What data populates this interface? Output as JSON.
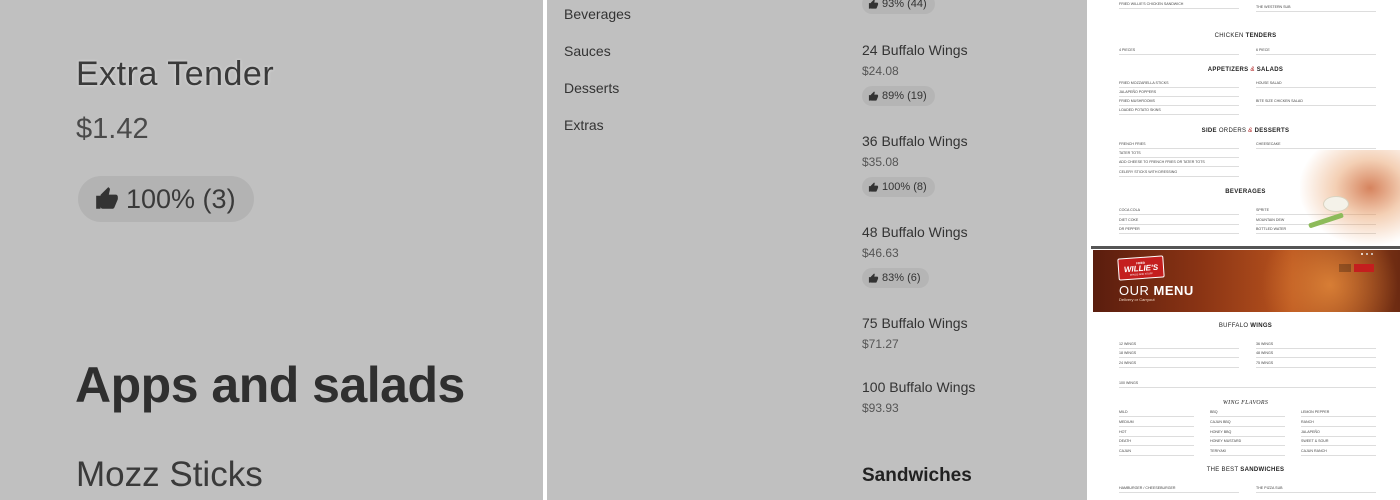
{
  "zoom_panel": {
    "item_name": "Extra Tender",
    "item_price": "$1.42",
    "rating": "100% (3)",
    "section_title": "Apps and salads",
    "next_item": "Mozz Sticks"
  },
  "menu_panel": {
    "categories": [
      "Beverages",
      "Sauces",
      "Desserts",
      "Extras"
    ],
    "top_rating": "93% (44)",
    "items": [
      {
        "name": "24 Buffalo Wings",
        "price": "$24.08",
        "rating": "89% (19)"
      },
      {
        "name": "36 Buffalo Wings",
        "price": "$35.08",
        "rating": "100% (8)"
      },
      {
        "name": "48 Buffalo Wings",
        "price": "$46.63",
        "rating": "83% (6)"
      },
      {
        "name": "75 Buffalo Wings",
        "price": "$71.27"
      },
      {
        "name": "100 Buffalo Wings",
        "price": "$93.93"
      }
    ],
    "next_section": "Sandwiches"
  },
  "website_panel": {
    "top_items": [
      {
        "name": "FRIED WILLIE'S CHICKEN SANDWICH"
      },
      {
        "name": "THE WESTERN SUB"
      }
    ],
    "chicken_tenders": {
      "title_light": "CHICKEN",
      "title_bold": "TENDERS",
      "items": [
        "4 PIECES",
        "6 PIECE"
      ]
    },
    "appetizers": {
      "title_a": "APPETIZERS",
      "amp": "&",
      "title_b": "SALADS",
      "left_items": [
        "FRIED MOZZARELLA STICKS",
        "JALAPEÑO POPPERS",
        "FRIED MUSHROOMS",
        "LOADED POTATO SKINS"
      ],
      "right_items": [
        "HOUSE SALAD",
        "BITE SIZE CHICKEN SALAD"
      ]
    },
    "sides": {
      "title_a": "SIDE",
      "title_light": "ORDERS",
      "amp": "&",
      "title_b": "DESSERTS",
      "left_items": [
        "FRENCH FRIES",
        "TATER TOTS",
        "ADD CHEESE TO FRENCH FRIES OR TATER TOTS",
        "CELERY STICKS WITH DRESSING"
      ],
      "right_items": [
        "CHEESECAKE"
      ]
    },
    "beverages": {
      "title": "BEVERAGES",
      "left_items": [
        "COCA COLA",
        "DIET COKE",
        "DR PEPPER"
      ],
      "right_items": [
        "SPRITE",
        "MOUNTAIN DEW",
        "BOTTLED WATER"
      ]
    },
    "hero": {
      "logo_top": "FRIED",
      "logo_main": "WILLIE'S",
      "logo_bottom": "WINGS AND STUFF",
      "title_light": "OUR",
      "title_bold": "MENU",
      "subtitle": "Delivery or Carryout"
    },
    "buffalo_wings": {
      "title_light": "BUFFALO",
      "title_bold": "WINGS",
      "left_items": [
        "12 WINGS",
        "18 WINGS",
        "24 WINGS"
      ],
      "right_items": [
        "36 WINGS",
        "48 WINGS",
        "75 WINGS"
      ],
      "extra_item": "100 WINGS"
    },
    "flavors": {
      "title": "WING FLAVORS",
      "col1": [
        "MILD",
        "MEDIUM",
        "HOT",
        "DEATH",
        "CAJUN"
      ],
      "col2": [
        "BBQ",
        "CAJUN BBQ",
        "HONEY BBQ",
        "HONEY MUSTARD",
        "TERIYAKI"
      ],
      "col3": [
        "LEMON PEPPER",
        "RANCH",
        "JALAPEÑO",
        "SWEET & SOUR",
        "CAJUN RANCH"
      ]
    },
    "sandwiches": {
      "title_light": "THE BEST",
      "title_bold": "SANDWICHES",
      "left_items": [
        "HAMBURGER / CHEESEBURGER"
      ],
      "right_items": [
        "THE PIZZA SUB"
      ]
    },
    "colors": {
      "accent_red": "#c41e1e",
      "hero_brown": "#8a3414"
    }
  }
}
